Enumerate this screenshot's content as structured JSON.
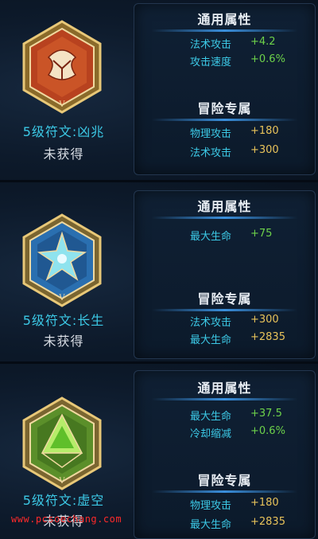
{
  "runes": [
    {
      "name": "5级符文:凶兆",
      "status": "未获得",
      "general_title": "通用属性",
      "general_stats": [
        {
          "name": "法术攻击",
          "value": "+4.2"
        },
        {
          "name": "攻击速度",
          "value": "+0.6%"
        }
      ],
      "adventure_title": "冒险专属",
      "adventure_stats": [
        {
          "name": "物理攻击",
          "value": "+180"
        },
        {
          "name": "法术攻击",
          "value": "+300"
        }
      ],
      "emblem_color": "#b8421f"
    },
    {
      "name": "5级符文:长生",
      "status": "未获得",
      "general_title": "通用属性",
      "general_stats": [
        {
          "name": "最大生命",
          "value": "+75"
        }
      ],
      "adventure_title": "冒险专属",
      "adventure_stats": [
        {
          "name": "法术攻击",
          "value": "+300"
        },
        {
          "name": "最大生命",
          "value": "+2835"
        }
      ],
      "emblem_color": "#2a6fb0"
    },
    {
      "name": "5级符文:虚空",
      "status": "未获得",
      "general_title": "通用属性",
      "general_stats": [
        {
          "name": "最大生命",
          "value": "+37.5"
        },
        {
          "name": "冷却缩减",
          "value": "+0.6%"
        }
      ],
      "adventure_title": "冒险专属",
      "adventure_stats": [
        {
          "name": "物理攻击",
          "value": "+180"
        },
        {
          "name": "最大生命",
          "value": "+2835"
        }
      ],
      "emblem_color": "#5b8f2a"
    }
  ],
  "watermark": "www.pcsoechang.com"
}
